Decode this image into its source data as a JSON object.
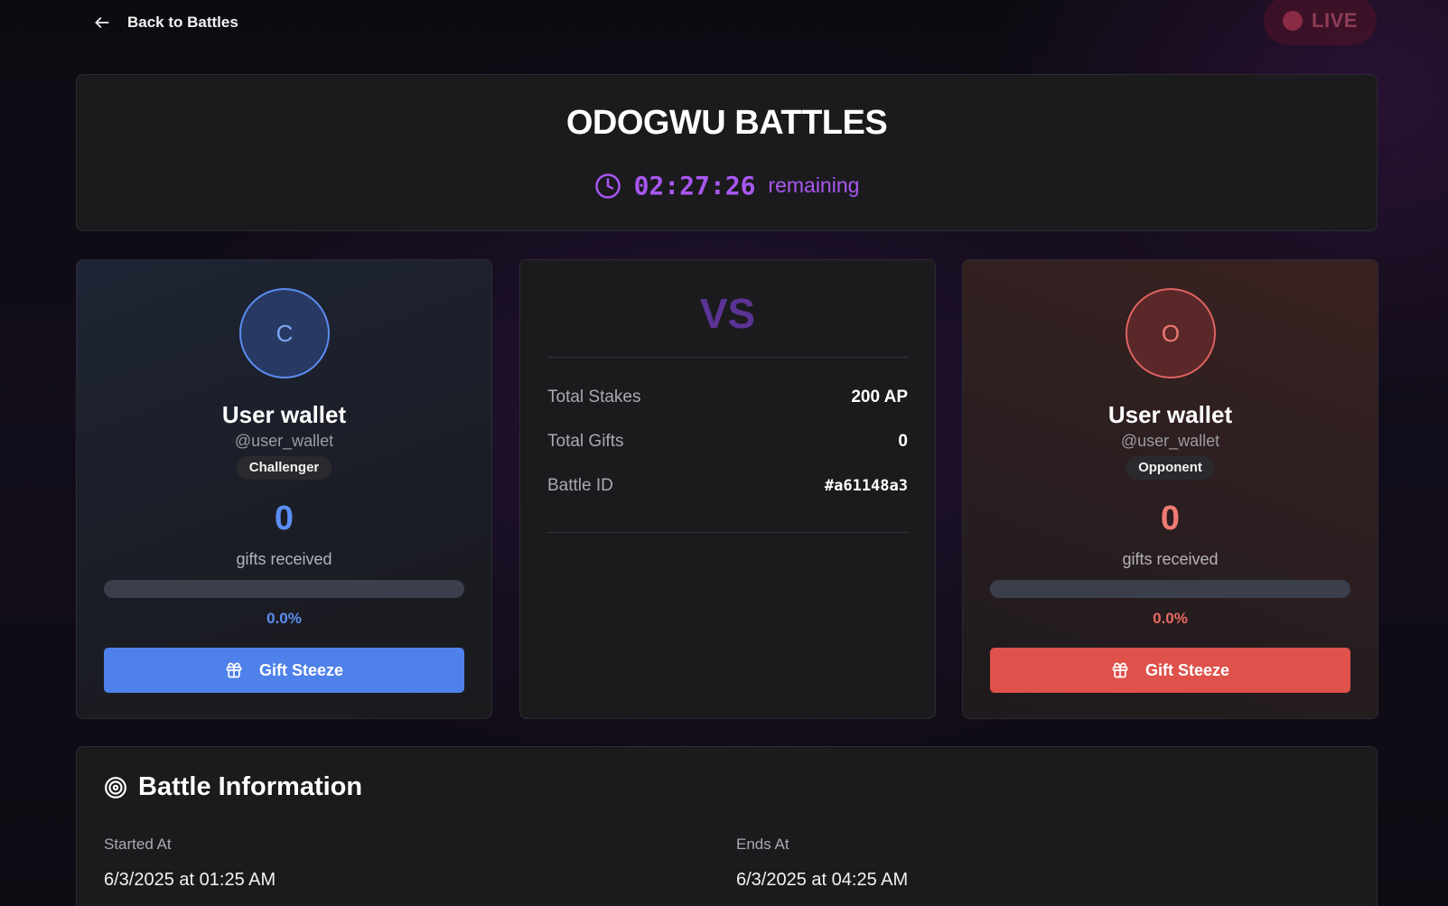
{
  "nav": {
    "back_label": "Back to Battles",
    "live_label": "LIVE"
  },
  "header": {
    "title": "ODOGWU BATTLES",
    "timer": "02:27:26",
    "timer_suffix": "remaining"
  },
  "challenger": {
    "initial": "C",
    "name": "User wallet",
    "handle": "@user_wallet",
    "role": "Challenger",
    "gifts": "0",
    "gifts_label": "gifts received",
    "share_text": "0.0%",
    "share_fraction": 0,
    "button_label": "Gift Steeze",
    "accent": "#4f81ea"
  },
  "opponent": {
    "initial": "O",
    "name": "User wallet",
    "handle": "@user_wallet",
    "role": "Opponent",
    "gifts": "0",
    "gifts_label": "gifts received",
    "share_text": "0.0%",
    "share_fraction": 0,
    "button_label": "Gift Steeze",
    "accent": "#df514b"
  },
  "center": {
    "vs": "VS",
    "stats": [
      {
        "label": "Total Stakes",
        "value": "200 AP"
      },
      {
        "label": "Total Gifts",
        "value": "0"
      },
      {
        "label": "Battle ID",
        "value": "#a61148a3"
      }
    ]
  },
  "info": {
    "title": "Battle Information",
    "started_label": "Started At",
    "started_value": "6/3/2025 at 01:25 AM",
    "ends_label": "Ends At",
    "ends_value": "6/3/2025 at 04:25 AM"
  },
  "icons": {
    "back": "arrow-left-icon",
    "timer": "clock-icon",
    "gift": "gift-icon",
    "info": "target-icon"
  }
}
